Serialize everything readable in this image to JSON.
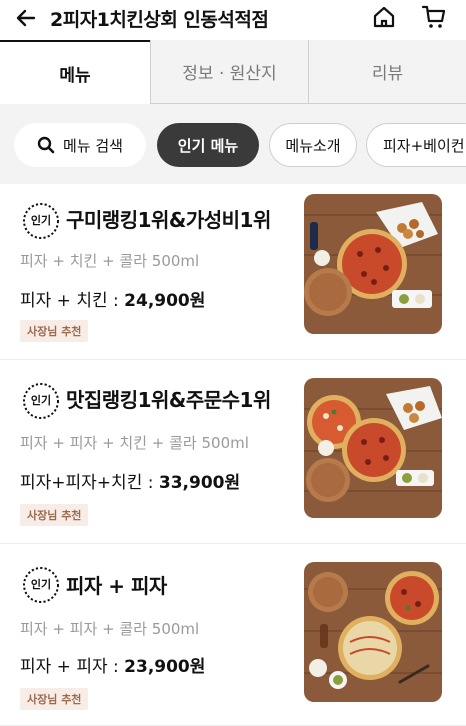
{
  "header": {
    "title": "2피자1치킨상회 인동석적점",
    "back_icon": "arrow-left-icon",
    "home_icon": "home-icon",
    "cart_icon": "cart-icon"
  },
  "tabs": [
    {
      "label": "메뉴",
      "active": true
    },
    {
      "label": "정보 · 원산지",
      "active": false
    },
    {
      "label": "리뷰",
      "active": false
    }
  ],
  "filters": {
    "search_label": "메뉴 검색",
    "chips": [
      "인기 메뉴",
      "메뉴소개",
      "피자+베이컨"
    ]
  },
  "menu_items": [
    {
      "badge": "인기",
      "name": "구미랭킹1위&가성비1위",
      "desc": "피자 + 치킨 + 콜라 500ml",
      "price_label": "피자 + 치킨 : ",
      "price": "24,900원",
      "recommend": "사장님 추천"
    },
    {
      "badge": "인기",
      "name": "맛집랭킹1위&주문수1위",
      "desc": "피자 + 피자 + 치킨 + 콜라 500ml",
      "price_label": "피자+피자+치킨 : ",
      "price": "33,900원",
      "recommend": "사장님 추천"
    },
    {
      "badge": "인기",
      "name": "피자 + 피자",
      "desc": "피자 + 피자 + 콜라 500ml",
      "price_label": "피자 + 피자 : ",
      "price": "23,900원",
      "recommend": "사장님 추천"
    }
  ],
  "colors": {
    "active_chip": "#3a3a3a",
    "recommend_bg": "#f8ece6",
    "recommend_text": "#9e6a4e",
    "wood": "#8a5a3b"
  }
}
